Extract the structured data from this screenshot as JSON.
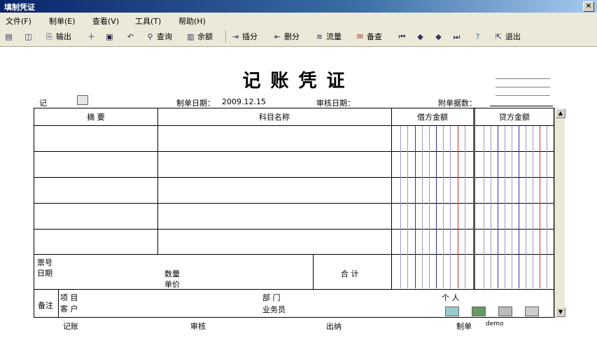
{
  "window": {
    "title": "填制凭证",
    "close_glyph": "×"
  },
  "menu": [
    "文件(F)",
    "制单(E)",
    "查看(V)",
    "工具(T)",
    "帮助(H)"
  ],
  "toolbar": {
    "output": "输出",
    "query": "查询",
    "balance": "余额",
    "insert": "插分",
    "delete": "删分",
    "flow": "流量",
    "check": "备查",
    "exit": "退出"
  },
  "voucher": {
    "title": "记账凭证",
    "type": "记",
    "make_date_label": "制单日期：",
    "make_date": "2009.12.15",
    "audit_date_label": "审核日期：",
    "attach_label": "附单据数：",
    "col_summary": "摘 要",
    "col_account": "科目名称",
    "col_debit": "借方金额",
    "col_credit": "贷方金额",
    "ticket_label": "票号",
    "date_label": "日期",
    "qty_label": "数量",
    "price_label": "单价",
    "total_label": "合 计",
    "remark_label": "备注",
    "project_label": "项 目",
    "customer_label": "客 户",
    "dept_label": "部 门",
    "person_label": "个 人",
    "salesman_label": "业务员"
  },
  "footer": {
    "bookkeep": "记账",
    "audit": "审核",
    "cashier": "出纳",
    "maker": "制单",
    "maker_name": "demo"
  }
}
